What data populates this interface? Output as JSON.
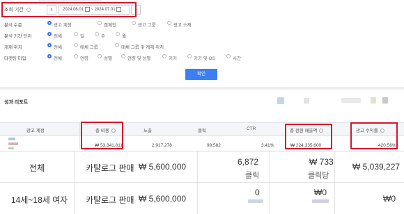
{
  "filters": {
    "period_label": "조회 기간",
    "date_start": "2024.06.01",
    "date_separator": "~",
    "date_end": "2024.07.01",
    "analysis_level_label": "분석 수준",
    "analysis_level_options": [
      "광고 계정",
      "캠페인",
      "광고 그룹",
      "광고 소재"
    ],
    "analysis_level_selected": 0,
    "period_unit_label": "분석 기간 단위",
    "period_unit_options": [
      "전체",
      "일",
      "주",
      "월"
    ],
    "period_unit_selected": 0,
    "placement_label": "게재 위치",
    "placement_options": [
      "전체",
      "매체 그룹",
      "매체 그룹 및 게재 위치"
    ],
    "placement_selected": 0,
    "targeting_label": "타겟팅 타입",
    "targeting_options": [
      "전체",
      "연령",
      "성별",
      "연령 및 성별",
      "기기",
      "기기 및 OS",
      "시간"
    ],
    "targeting_selected": 0,
    "confirm_button": "확인"
  },
  "report": {
    "title": "성과 리포트",
    "columns": [
      "광고 계정",
      "총 비용",
      "노출",
      "클릭",
      "CTR",
      "총 전환 매출액",
      "광고 수익률"
    ],
    "row": {
      "cost": "₩ 53,341,811",
      "impressions": "2,917,278",
      "clicks": "99,582",
      "ctr": "3.41%",
      "revenue": "₩ 224,335,600",
      "roas": "420.56%"
    }
  },
  "overlay_table": {
    "rows": [
      {
        "name": "전체",
        "type": "카탈로그 판매",
        "budget": "₩ 5,600,000",
        "clicks": "6,872",
        "clicks_unit": "클릭",
        "cpc": "₩ 733",
        "cpc_unit": "클릭당",
        "spend": "₩ 5,039,227"
      },
      {
        "name": "14세~18세 여자",
        "type": "카탈로그 판매",
        "budget": "₩ 5,600,000",
        "clicks": "0",
        "cpc": "₩0",
        "spend": "₩0"
      }
    ]
  },
  "colors": {
    "accent": "#3b7ff3",
    "highlight_red": "#d9152b",
    "header_bg": "#f3f5f8"
  }
}
